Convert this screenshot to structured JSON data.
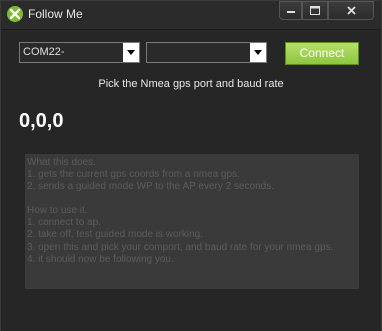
{
  "window": {
    "title": "Follow Me",
    "controls": {
      "minimize": "–",
      "maximize": "□",
      "close": "✕"
    }
  },
  "form": {
    "port_select": {
      "value": "COM22-"
    },
    "baud_select": {
      "value": ""
    },
    "connect_label": "Connect",
    "hint": "Pick the Nmea gps port and baud rate"
  },
  "coords": "0,0,0",
  "info": {
    "lines": [
      "What this does.",
      "1. gets the current gps coords from a nmea gps.",
      "2. sends a guided mode WP to the AP every 2 seconds.",
      "",
      "How to use it.",
      "1. connect to ap.",
      "2. take off, test guided mode is working.",
      "3. open this and pick your comport, and baud rate for your nmea gps.",
      "4. it should now be following you."
    ]
  },
  "colors": {
    "accent": "#8cc63f",
    "background": "#262626",
    "panel": "#3a3a3a",
    "panel_text": "#5c5c5c"
  },
  "icons": {
    "app": "app-logo-icon",
    "dropdown": "chevron-down-icon"
  }
}
